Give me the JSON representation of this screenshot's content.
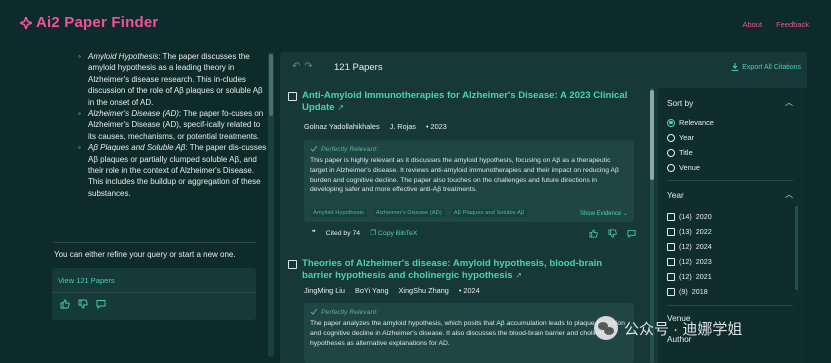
{
  "app": {
    "title": "Ai2 Paper Finder",
    "links": [
      "About",
      "Feedback"
    ],
    "accent": "#f0529c",
    "brand_green": "#4ad3a8"
  },
  "chat": {
    "bullets": [
      {
        "term": "Amyloid Hypothesis",
        "text": ": The paper discusses the amyloid hypothesis as a leading theory in Alzheimer's disease research. This in-cludes discussion of the role of Aβ plaques or soluble Aβ in the onset of AD."
      },
      {
        "term": "Alzheimer's Disease (AD)",
        "text": ": The paper fo-cuses on Alzheimer's Disease (AD), specif-ically related to its causes, mechanisms, or potential treatments."
      },
      {
        "term": "Aβ Plaques and Soluble Aβ",
        "text": ": The paper dis-cusses Aβ plaques or partially clumped soluble Aβ, and their role in the context of Alzheimer's Disease. This includes the buildup or aggregation of these substances."
      }
    ],
    "refine_text": "You can either refine your query or start a new one.",
    "view_link": "View 121 Papers"
  },
  "results": {
    "count": "121 Papers",
    "export": "Export All Citations",
    "papers": [
      {
        "title": "Anti-Amyloid Immunotherapies for Alzheimer's Disease: A 2023 Clinical Update",
        "authors": [
          "Golnaz Yadollahikhales",
          "J. Rojas"
        ],
        "year": "2023",
        "relevance": "Perfectly Relevant:",
        "summary": "This paper is highly relevant as it discusses the amyloid hypothesis, focusing on Aβ as a therapeutic target in Alzheimer's disease. It reviews anti-amyloid immunotherapies and their impact on reducing Aβ burden and cognitive decline. The paper also touches on the challenges and future directions in developing safer and more effective anti-Aβ treatments.",
        "chips": [
          "Amyloid Hypothesis",
          "Alzheimer's Disease (AD)",
          "Aβ Plaques and Soluble Aβ"
        ],
        "show_evidence": "Show Evidence",
        "cited_by": "Cited by 74",
        "copy_bibtex": "Copy BibTeX"
      },
      {
        "title": "Theories of Alzheimer's disease: Amyloid hypothesis, blood-brain barrier hypothesis and cholinergic hypothesis",
        "authors": [
          "JingMing Liu",
          "BoYi Yang",
          "XingShu Zhang"
        ],
        "year": "2024",
        "relevance": "Perfectly Relevant:",
        "summary": "The paper analyzes the amyloid hypothesis, which posits that Aβ accumulation leads to plaque formation and cognitive decline in Alzheimer's disease. It also discusses the blood-brain barrier and cholinergic hypotheses as alternative explanations for AD."
      }
    ]
  },
  "sidebar": {
    "sort_title": "Sort by",
    "sort_options": [
      "Relevance",
      "Year",
      "Title",
      "Venue"
    ],
    "sort_selected": "Relevance",
    "year_title": "Year",
    "years": [
      {
        "count": "(14)",
        "year": "2020"
      },
      {
        "count": "(13)",
        "year": "2022"
      },
      {
        "count": "(12)",
        "year": "2024"
      },
      {
        "count": "(12)",
        "year": "2023"
      },
      {
        "count": "(12)",
        "year": "2021"
      },
      {
        "count": "(9)",
        "year": "2018"
      }
    ],
    "venue_title": "Venue",
    "author_title": "Author"
  },
  "watermark": {
    "text": "公众号 · 迪娜学姐"
  }
}
